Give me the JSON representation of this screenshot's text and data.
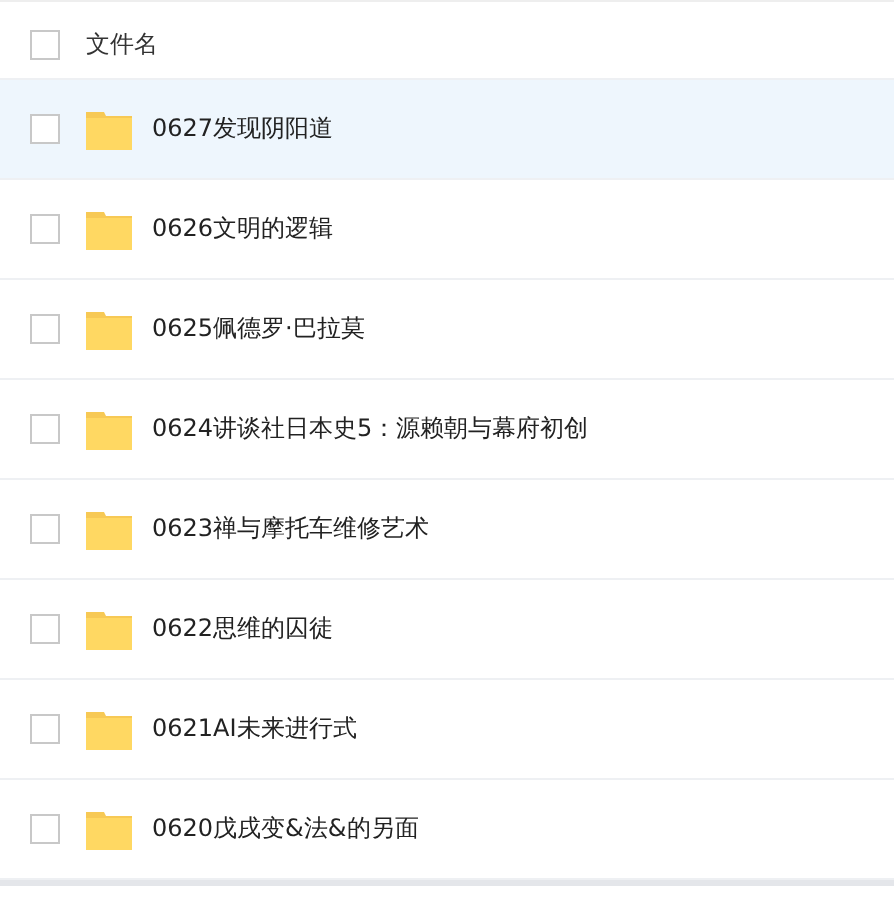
{
  "header": {
    "label": "文件名",
    "checked": false
  },
  "rows": [
    {
      "name": "0627发现阴阳道",
      "selected": true,
      "checked": false
    },
    {
      "name": "0626文明的逻辑",
      "selected": false,
      "checked": false
    },
    {
      "name": "0625佩德罗·巴拉莫",
      "selected": false,
      "checked": false
    },
    {
      "name": "0624讲谈社日本史5：源赖朝与幕府初创",
      "selected": false,
      "checked": false
    },
    {
      "name": "0623禅与摩托车维修艺术",
      "selected": false,
      "checked": false
    },
    {
      "name": "0622思维的囚徒",
      "selected": false,
      "checked": false
    },
    {
      "name": "0621AI未来进行式",
      "selected": false,
      "checked": false
    },
    {
      "name": "0620戊戌变&法&的另面",
      "selected": false,
      "checked": false
    }
  ]
}
